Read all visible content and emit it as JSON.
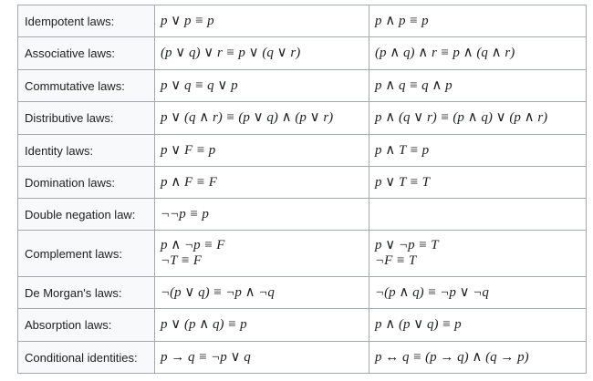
{
  "table": {
    "rows": [
      {
        "name": "Idempotent laws:",
        "left": [
          "p ∨ p ≡ p"
        ],
        "right": [
          "p ∧ p ≡ p"
        ]
      },
      {
        "name": "Associative laws:",
        "left": [
          "(p ∨ q) ∨ r ≡ p ∨ (q ∨ r)"
        ],
        "right": [
          "(p ∧ q) ∧ r ≡ p ∧ (q ∧ r)"
        ]
      },
      {
        "name": "Commutative laws:",
        "left": [
          "p ∨ q ≡ q ∨ p"
        ],
        "right": [
          "p ∧ q ≡ q ∧ p"
        ]
      },
      {
        "name": "Distributive laws:",
        "left": [
          "p ∨ (q ∧ r) ≡ (p ∨ q) ∧ (p ∨ r)"
        ],
        "right": [
          "p ∧ (q ∨ r) ≡ (p ∧ q) ∨ (p ∧ r)"
        ]
      },
      {
        "name": "Identity laws:",
        "left": [
          "p ∨ F ≡ p"
        ],
        "right": [
          "p ∧ T ≡ p"
        ]
      },
      {
        "name": "Domination laws:",
        "left": [
          "p ∧ F ≡ F"
        ],
        "right": [
          "p ∨ T ≡ T"
        ]
      },
      {
        "name": "Double negation law:",
        "left": [
          "¬¬p ≡ p"
        ],
        "right": []
      },
      {
        "name": "Complement laws:",
        "left": [
          "p ∧ ¬p ≡ F",
          "¬T ≡ F"
        ],
        "right": [
          "p ∨ ¬p ≡ T",
          "¬F ≡ T"
        ]
      },
      {
        "name": "De Morgan's laws:",
        "left": [
          "¬(p ∨ q) ≡ ¬p ∧ ¬q"
        ],
        "right": [
          "¬(p ∧ q) ≡ ¬p ∨ ¬q"
        ]
      },
      {
        "name": "Absorption laws:",
        "left": [
          "p ∨ (p ∧ q) ≡ p"
        ],
        "right": [
          "p ∧ (p ∨ q) ≡ p"
        ]
      },
      {
        "name": "Conditional identities:",
        "left": [
          "p → q ≡ ¬p ∨ q"
        ],
        "right": [
          "p ↔ q ≡ (p → q) ∧ (q → p)"
        ]
      }
    ]
  }
}
